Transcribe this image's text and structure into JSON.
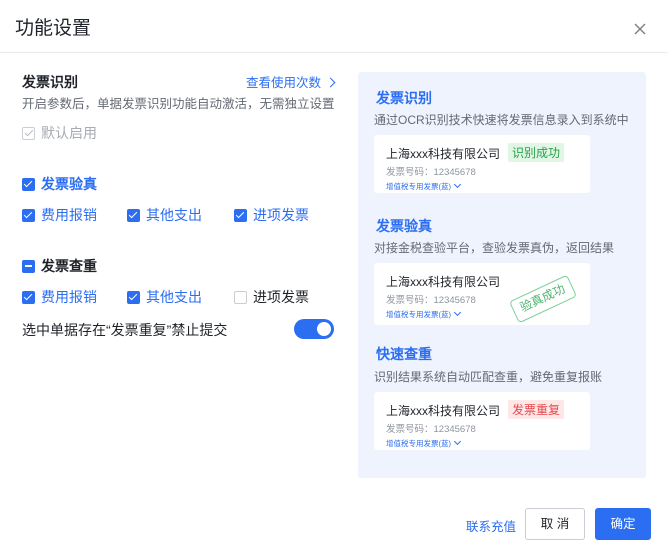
{
  "dialog": {
    "title": "功能设置",
    "close_icon": "close-icon"
  },
  "recognition": {
    "title": "发票识别",
    "usage_link": "查看使用次数",
    "description": "开启参数后，单据发票识别功能自动激活，无需独立设置",
    "default_enabled": {
      "label": "默认启用",
      "checked": true,
      "disabled": true
    }
  },
  "verification": {
    "title": "发票验真",
    "checked": true,
    "options": [
      {
        "label": "费用报销",
        "checked": true
      },
      {
        "label": "其他支出",
        "checked": true
      },
      {
        "label": "进项发票",
        "checked": true
      }
    ]
  },
  "duplicate": {
    "title": "发票查重",
    "state": "indeterminate",
    "options": [
      {
        "label": "费用报销",
        "checked": true
      },
      {
        "label": "其他支出",
        "checked": true
      },
      {
        "label": "进项发票",
        "checked": false
      }
    ],
    "block_label": "选中单据存在“发票重复”禁止提交",
    "block_enabled": true
  },
  "preview": {
    "sections": [
      {
        "title": "发票识别",
        "description": "通过OCR识别技术快速将发票信息录入到系统中",
        "company": "上海xxx科技有限公司",
        "invoice_no": "发票号码：12345678",
        "invoice_type": "增值税专用发票(蓝)",
        "badge": "识别成功"
      },
      {
        "title": "发票验真",
        "description": "对接金税查验平台，查验发票真伪，返回结果",
        "company": "上海xxx科技有限公司",
        "invoice_no": "发票号码：12345678",
        "invoice_type": "增值税专用发票(蓝)",
        "stamp": "验真成功"
      },
      {
        "title": "快速查重",
        "description": "识别结果系统自动匹配查重，避免重复报账",
        "company": "上海xxx科技有限公司",
        "invoice_no": "发票号码：12345678",
        "invoice_type": "增值税专用发票(蓝)",
        "badge": "发票重复"
      }
    ]
  },
  "footer": {
    "recharge": "联系充值",
    "cancel": "取 消",
    "confirm": "确定"
  },
  "colors": {
    "primary": "#2b6ef2",
    "success": "#27a04a",
    "danger": "#e5484d",
    "panel_bg": "#eef3fd"
  }
}
